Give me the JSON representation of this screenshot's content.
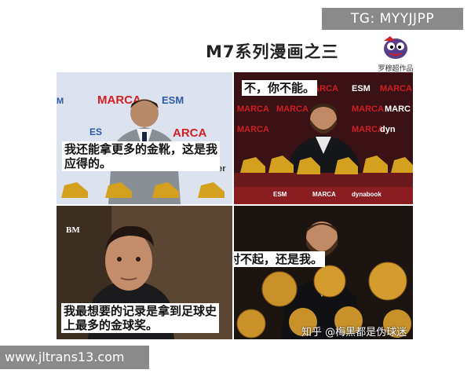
{
  "tag_label": "TG: MYYJJPP",
  "title": "M7系列漫画之三",
  "logo_caption": "罗穆超作品",
  "panels": [
    {
      "caption": "我还能拿更多的金靴，这是我应得的。",
      "caption_lines": [
        "我还能拿更多的金靴，这是我",
        "应得的。"
      ]
    },
    {
      "caption": "不，你不能。"
    },
    {
      "caption": "我最想要的记录是拿到足球史上最多的金球奖。",
      "caption_lines": [
        "我最想要的记录是拿到足球史",
        "上最多的金球奖。"
      ]
    },
    {
      "caption": "对不起，还是我。"
    }
  ],
  "zhihu_credit": "知乎 @梅黑都是伪球迷",
  "watermark": "www.jltrans13.com",
  "colors": {
    "marca_red": "#d21f26",
    "gold": "#d4a11e",
    "esm_blue": "#2a5aa8"
  }
}
